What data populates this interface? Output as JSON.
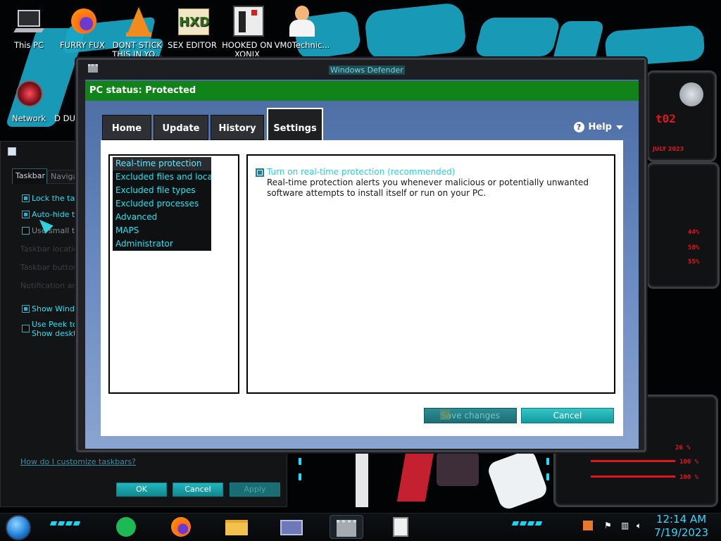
{
  "desktop": {
    "icons": [
      {
        "label": "This PC",
        "icon": "computer-icon"
      },
      {
        "label": "FURRY FUX",
        "icon": "firefox-icon"
      },
      {
        "label": "DONT STICK THIS IN YO...",
        "icon": "vlc-icon"
      },
      {
        "label": "SEX EDITOR",
        "icon": "hex-editor-icon"
      },
      {
        "label": "HOOKED ON XONIX",
        "icon": "game-icon"
      },
      {
        "label": "VM0Technic...",
        "icon": "doctor-icon"
      },
      {
        "label": "Network",
        "icon": "network-icon"
      },
      {
        "label": "D DU",
        "icon": "partial-icon"
      }
    ],
    "widget_text": {
      "line1": "t02",
      "line2": "JULY 2023",
      "pcts": [
        "44%",
        "58%",
        "55%",
        "26 %",
        "100 %",
        "100 %"
      ]
    }
  },
  "taskbar_properties": {
    "tabs": [
      "Taskbar",
      "Naviga"
    ],
    "options": [
      {
        "label": "Lock the task",
        "checked": true
      },
      {
        "label": "Auto-hide th",
        "checked": true
      },
      {
        "label": "Use small tas",
        "checked": false
      }
    ],
    "dim_rows": [
      "Taskbar location",
      "Taskbar buttons",
      "Notification area"
    ],
    "show_windows": {
      "label": "Show Window",
      "checked": true
    },
    "use_peek": {
      "line1": "Use Peek to",
      "line2": "Show deskto",
      "checked": false
    },
    "help_link": "How do I customize taskbars?",
    "buttons": {
      "ok": "OK",
      "cancel": "Cancel",
      "apply": "Apply"
    }
  },
  "defender": {
    "title": "Windows Defender",
    "status": "PC status: Protected",
    "tabs": [
      "Home",
      "Update",
      "History",
      "Settings"
    ],
    "active_tab": "Settings",
    "help": "Help",
    "nav": [
      "Real-time protection",
      "Excluded files and locat...",
      "Excluded file types",
      "Excluded processes",
      "Advanced",
      "MAPS",
      "Administrator"
    ],
    "selected_nav": "Real-time protection",
    "option": {
      "label": "Turn on real-time protection (recommended)",
      "checked": true,
      "description": "Real-time protection alerts you whenever malicious or potentially unwanted software attempts to install itself or run on your PC."
    },
    "buttons": {
      "save": "Save changes",
      "cancel": "Cancel"
    },
    "colors": {
      "status_green": "#108418",
      "accent_cyan": "#1ee5f2"
    }
  },
  "taskbar": {
    "apps": [
      {
        "name": "Spotify",
        "icon": "spotify-icon"
      },
      {
        "name": "Firefox",
        "icon": "firefox-icon"
      },
      {
        "name": "File Explorer",
        "icon": "folder-icon"
      },
      {
        "name": "Control Panel",
        "icon": "control-panel-icon"
      },
      {
        "name": "Windows Defender",
        "icon": "defender-castle-icon",
        "active": true
      },
      {
        "name": "Task Manager",
        "icon": "clipboard-icon"
      }
    ],
    "clock": {
      "time": "12:14 AM",
      "date": "7/19/2023"
    }
  }
}
